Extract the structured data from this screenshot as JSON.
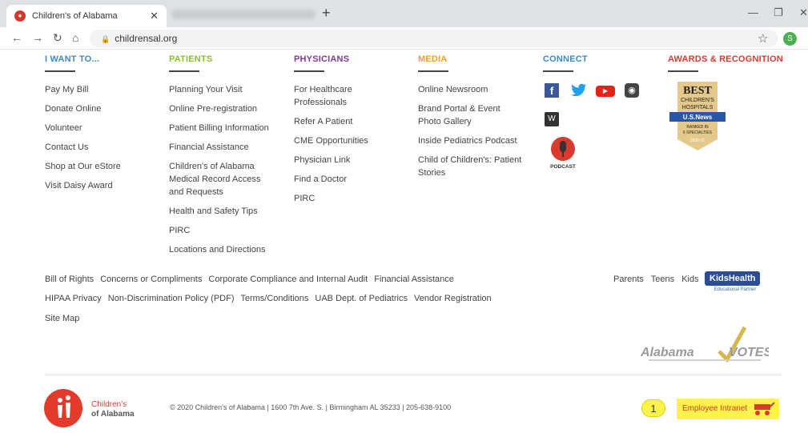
{
  "browser": {
    "tab_title": "Children's of Alabama",
    "tab_close": "✕",
    "new_tab": "+",
    "url": "childrensal.org",
    "avatar_letter": "S"
  },
  "columns": [
    {
      "heading": "I WANT TO...",
      "links": [
        "Pay My Bill",
        "Donate Online",
        "Volunteer",
        "Contact Us",
        "Shop at Our eStore",
        "Visit Daisy Award"
      ]
    },
    {
      "heading": "PATIENTS",
      "links": [
        "Planning Your Visit",
        "Online Pre-registration",
        "Patient Billing Information",
        "Financial Assistance",
        "Children's of Alabama Medical Record Access and Requests",
        "Health and Safety Tips",
        "PIRC",
        "Locations and Directions"
      ]
    },
    {
      "heading": "PHYSICIANS",
      "links": [
        "For Healthcare Professionals",
        "Refer A Patient",
        "CME Opportunities",
        "Physician Link",
        "Find a Doctor",
        "PIRC"
      ]
    },
    {
      "heading": "MEDIA",
      "links": [
        "Online Newsroom",
        "Brand Portal & Event Photo Gallery",
        "Inside Pediatrics Podcast",
        "Child of Children's: Patient Stories"
      ]
    },
    {
      "heading": "CONNECT"
    },
    {
      "heading": "AWARDS & RECOGNITION"
    }
  ],
  "social": {
    "facebook": "f",
    "twitter": "🐦",
    "youtube": "▶",
    "instagram": "◉",
    "wordpress": "W",
    "podcast_label": "PODCAST"
  },
  "award": {
    "line1": "BEST",
    "line2": "CHILDREN'S",
    "line3": "HOSPITALS",
    "line4": "U.S.News",
    "line5": "RANKED IN",
    "line6": "6 SPECIALTIES",
    "line7": "2020-21"
  },
  "bottom_links": {
    "row1": [
      "Bill of Rights",
      "Concerns or Compliments",
      "Corporate Compliance and Internal Audit",
      "Financial Assistance"
    ],
    "row2": [
      "HIPAA Privacy",
      "Non-Discrimination Policy (PDF)",
      "Terms/Conditions",
      "UAB Dept. of Pediatrics",
      "Vendor Registration"
    ],
    "row3": [
      "Site Map"
    ]
  },
  "audience": [
    "Parents",
    "Teens",
    "Kids"
  ],
  "kidshealth": {
    "logo": "KidsHealth",
    "sub": "Educational Partner"
  },
  "alabama_votes": {
    "text1": "Alabama",
    "text2": "VOTES"
  },
  "footer": {
    "logo_line1": "Children's",
    "logo_line2": "of Alabama",
    "copyright": "© 2020 Children's of Alabama | 1600 7th Ave. S. | Birmingham AL 35233 | 205-638-9100",
    "annotation_number": "1",
    "employee_intranet": "Employee Intranet"
  },
  "colors": {
    "red": "#d93b2e",
    "highlight": "#fff24a",
    "blue": "#3c8ac6",
    "green": "#8bbf2c",
    "purple": "#7a3aa0",
    "orange": "#f0a020"
  }
}
